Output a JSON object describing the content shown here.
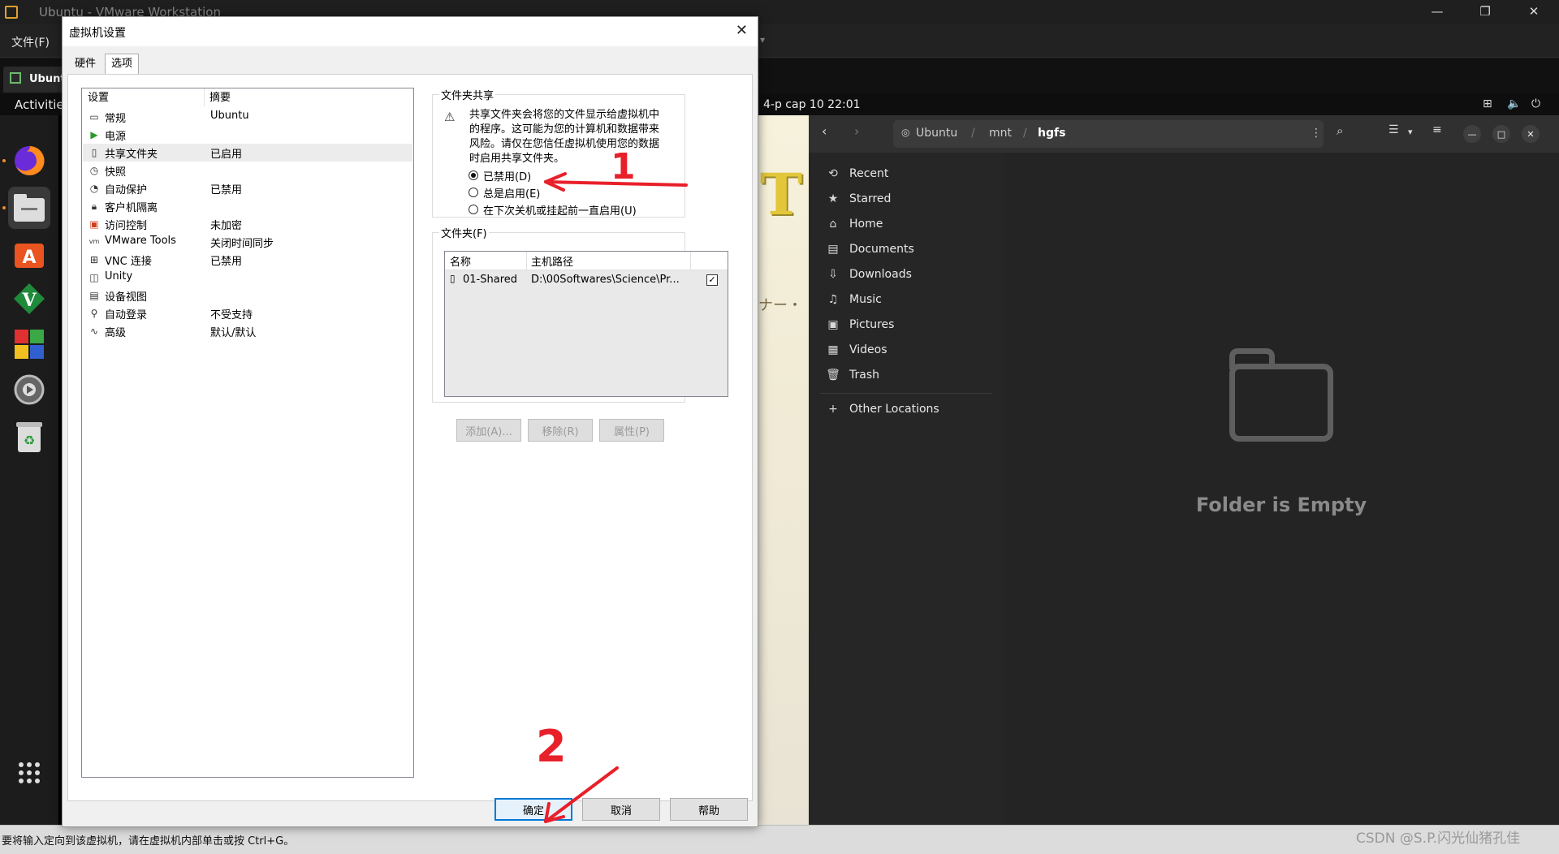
{
  "host": {
    "title": "Ubuntu - VMware Workstation",
    "menu_file": "文件(F)",
    "vm_tab": "Ubuntu"
  },
  "guest": {
    "activities": "Activities",
    "clock": "4-p cap 10  22:01",
    "dock": [
      "firefox-icon",
      "files-icon",
      "software-center-icon",
      "vim-icon",
      "colorful-app-icon",
      "settings-icon",
      "trash-icon",
      "app-grid-icon"
    ],
    "files": {
      "path": [
        "Ubuntu",
        "mnt",
        "hgfs"
      ],
      "sidebar": [
        "Recent",
        "Starred",
        "Home",
        "Documents",
        "Downloads",
        "Music",
        "Pictures",
        "Videos",
        "Trash"
      ],
      "other_locations": "Other Locations",
      "empty_text": "Folder is Empty"
    },
    "wallpaper_kana": "ナー・"
  },
  "dialog": {
    "title": "虚拟机设置",
    "tabs": [
      "硬件",
      "选项"
    ],
    "list_header": {
      "col1": "设置",
      "col2": "摘要"
    },
    "settings": [
      {
        "name": "常规",
        "summary": "Ubuntu",
        "icon": "general-icon"
      },
      {
        "name": "电源",
        "summary": "",
        "icon": "power-icon"
      },
      {
        "name": "共享文件夹",
        "summary": "已启用",
        "icon": "shared-folders-icon"
      },
      {
        "name": "快照",
        "summary": "",
        "icon": "snapshot-icon"
      },
      {
        "name": "自动保护",
        "summary": "已禁用",
        "icon": "autoprotect-icon"
      },
      {
        "name": "客户机隔离",
        "summary": "",
        "icon": "isolation-icon"
      },
      {
        "name": "访问控制",
        "summary": "未加密",
        "icon": "access-control-icon"
      },
      {
        "name": "VMware Tools",
        "summary": "关闭时间同步",
        "icon": "vmware-tools-icon"
      },
      {
        "name": "VNC 连接",
        "summary": "已禁用",
        "icon": "vnc-icon"
      },
      {
        "name": "Unity",
        "summary": "",
        "icon": "unity-icon"
      },
      {
        "name": "设备视图",
        "summary": "",
        "icon": "device-view-icon"
      },
      {
        "name": "自动登录",
        "summary": "不受支持",
        "icon": "autologin-icon"
      },
      {
        "name": "高级",
        "summary": "默认/默认",
        "icon": "advanced-icon"
      }
    ],
    "sharing": {
      "group_title": "文件夹共享",
      "warning_lines": [
        "共享文件夹会将您的文件显示给虚拟机中",
        "的程序。这可能为您的计算机和数据带来",
        "风险。请仅在您信任虚拟机使用您的数据",
        "时启用共享文件夹。"
      ],
      "options": [
        "已禁用(D)",
        "总是启用(E)",
        "在下次关机或挂起前一直启用(U)"
      ],
      "selected_index": 0
    },
    "folders": {
      "group_title": "文件夹(F)",
      "headers": {
        "name": "名称",
        "path": "主机路径"
      },
      "rows": [
        {
          "name": "01-Shared",
          "path": "D:\\00Softwares\\Science\\Pr...",
          "checked": true
        }
      ],
      "buttons": {
        "add": "添加(A)...",
        "remove": "移除(R)",
        "properties": "属性(P)"
      }
    },
    "footer": {
      "ok": "确定",
      "cancel": "取消",
      "help": "帮助"
    }
  },
  "annotations": {
    "one": "1",
    "two": "2",
    "color": "#e8202a"
  },
  "statusbar": "要将输入定向到该虚拟机，请在虚拟机内部单击或按 Ctrl+G。",
  "watermark": "CSDN @S.P.闪光仙猪孔佳"
}
